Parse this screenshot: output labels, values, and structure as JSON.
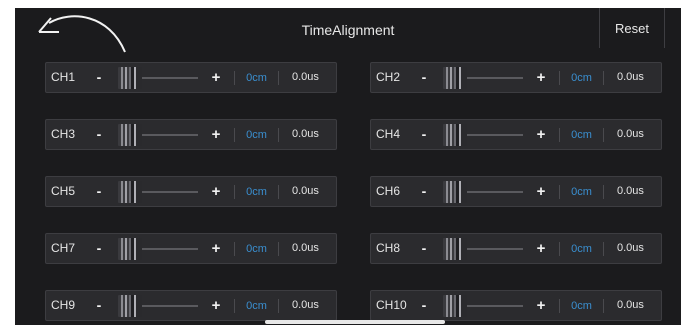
{
  "header": {
    "title": "TimeAlignment",
    "reset_label": "Reset",
    "back_icon": "undo-arrow-icon"
  },
  "controls": {
    "minus_symbol": "-",
    "plus_symbol": "+"
  },
  "channels": [
    {
      "label": "CH1",
      "distance": "0cm",
      "time": "0.0us",
      "level": 0
    },
    {
      "label": "CH2",
      "distance": "0cm",
      "time": "0.0us",
      "level": 0
    },
    {
      "label": "CH3",
      "distance": "0cm",
      "time": "0.0us",
      "level": 0
    },
    {
      "label": "CH4",
      "distance": "0cm",
      "time": "0.0us",
      "level": 0
    },
    {
      "label": "CH5",
      "distance": "0cm",
      "time": "0.0us",
      "level": 0
    },
    {
      "label": "CH6",
      "distance": "0cm",
      "time": "0.0us",
      "level": 0
    },
    {
      "label": "CH7",
      "distance": "0cm",
      "time": "0.0us",
      "level": 0
    },
    {
      "label": "CH8",
      "distance": "0cm",
      "time": "0.0us",
      "level": 0
    },
    {
      "label": "CH9",
      "distance": "0cm",
      "time": "0.0us",
      "level": 0
    },
    {
      "label": "CH10",
      "distance": "0cm",
      "time": "0.0us",
      "level": 0
    }
  ],
  "colors": {
    "background": "#1b1b1d",
    "row_background": "#2b2b2e",
    "distance_text": "#3a8fd0"
  }
}
